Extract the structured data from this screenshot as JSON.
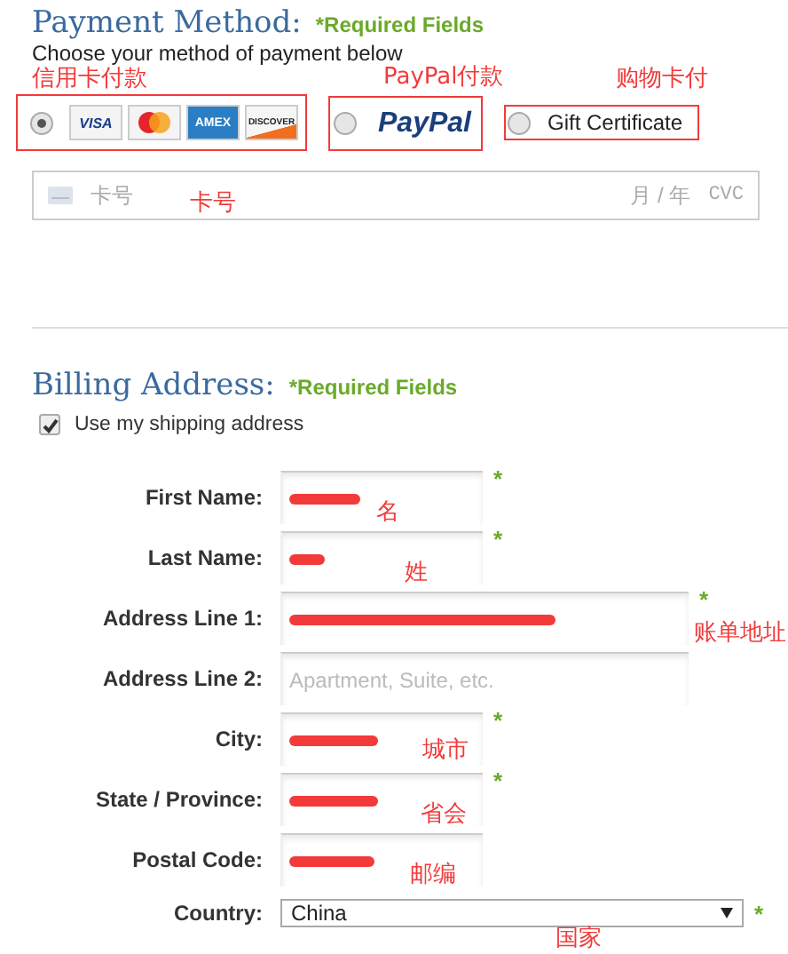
{
  "payment": {
    "title": "Payment Method:",
    "required": "*Required Fields",
    "instruction": "Choose your method of payment below",
    "options": [
      {
        "kind": "cards",
        "selected": true,
        "highlighted": true,
        "logos": [
          {
            "kind": "visa",
            "text": "VISA"
          },
          {
            "kind": "mastercard"
          },
          {
            "kind": "amex",
            "text": "AMEX"
          },
          {
            "kind": "discover",
            "text": "DISCOVER"
          }
        ]
      },
      {
        "kind": "paypal",
        "selected": false,
        "highlighted": true,
        "text": "PayPal"
      },
      {
        "kind": "gift",
        "selected": false,
        "highlighted": true,
        "label": "Gift Certificate"
      }
    ],
    "card_field": {
      "placeholder": "卡号",
      "expiry_placeholder": "月 / 年",
      "cvc_placeholder": "CVC"
    }
  },
  "billing": {
    "title": "Billing Address:",
    "required": "*Required Fields",
    "use_shipping": {
      "label": "Use my shipping address",
      "checked": true
    },
    "fields": [
      {
        "kind": "short",
        "label": "First Name:",
        "redacted": true,
        "required_mark": "*"
      },
      {
        "kind": "short",
        "label": "Last Name:",
        "redacted": true,
        "required_mark": "*"
      },
      {
        "kind": "long",
        "label": "Address Line 1:",
        "redacted": true,
        "required_mark": "*"
      },
      {
        "kind": "long",
        "label": "Address Line 2:",
        "placeholder": "Apartment, Suite, etc."
      },
      {
        "kind": "short",
        "label": "City:",
        "redacted": true,
        "required_mark": "*"
      },
      {
        "kind": "short",
        "label": "State / Province:",
        "redacted": true,
        "required_mark": "*"
      },
      {
        "kind": "short",
        "label": "Postal Code:",
        "redacted": true
      },
      {
        "kind": "select",
        "label": "Country:",
        "value": "China",
        "required_mark": "*"
      }
    ]
  },
  "annotations": [
    {
      "text": "信用卡付款"
    },
    {
      "text": "PayPal付款"
    },
    {
      "text": "购物卡付"
    },
    {
      "text": "卡号"
    },
    {
      "text": "名"
    },
    {
      "text": "姓"
    },
    {
      "text": "账单地址"
    },
    {
      "text": "城市"
    },
    {
      "text": "省会"
    },
    {
      "text": "邮编"
    },
    {
      "text": "国家"
    }
  ]
}
